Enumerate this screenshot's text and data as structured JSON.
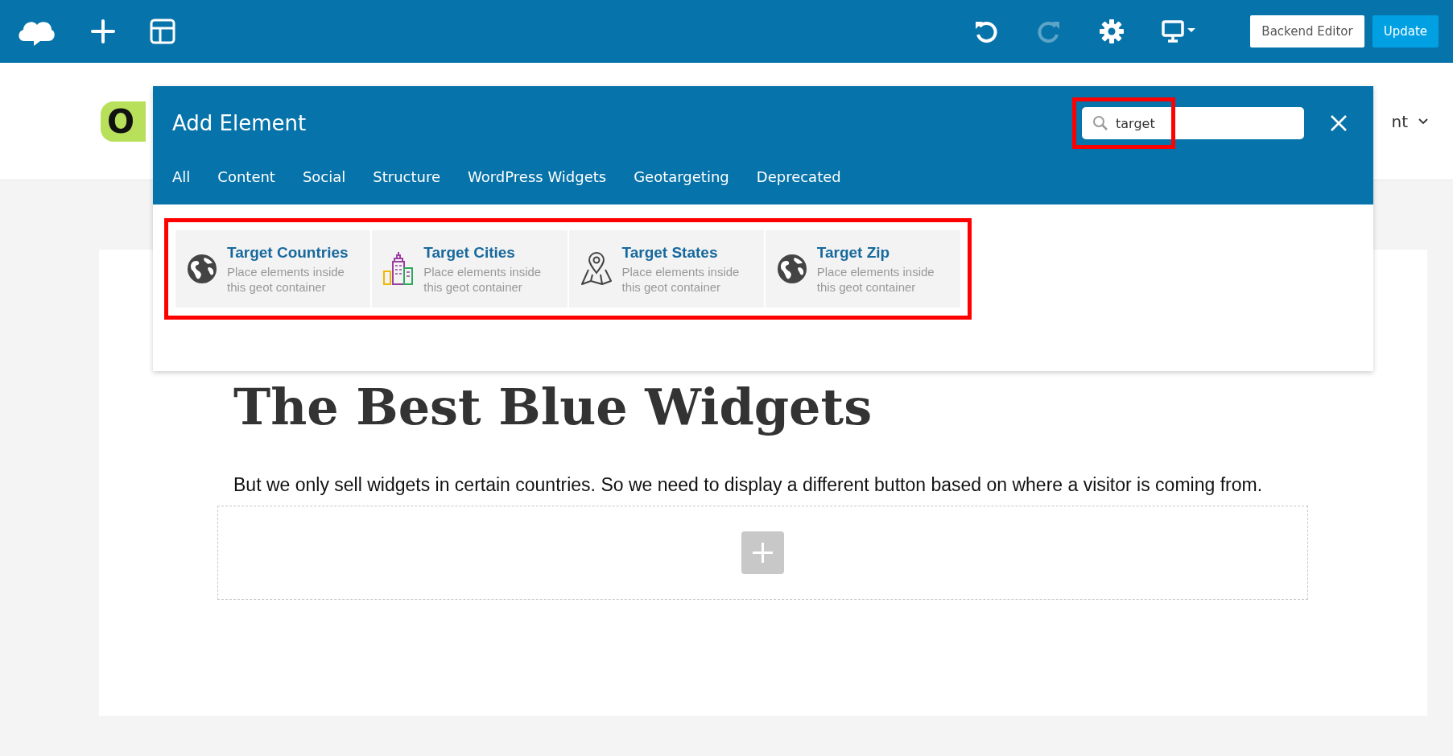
{
  "toolbar": {
    "left_icons": [
      {
        "kind": "logo",
        "disabled": false
      },
      {
        "kind": "add",
        "disabled": false
      },
      {
        "kind": "layout",
        "disabled": false
      }
    ],
    "right_icons": [
      {
        "kind": "undo",
        "disabled": false
      },
      {
        "kind": "redo",
        "disabled": true
      },
      {
        "kind": "settings",
        "disabled": false
      },
      {
        "kind": "device",
        "disabled": false
      }
    ],
    "buttons": [
      {
        "label": "Backend Editor",
        "kind": "secondary"
      },
      {
        "label": "Update",
        "kind": "primary"
      }
    ]
  },
  "site_header": {
    "logo_text": "O",
    "menu_item": "nt"
  },
  "modal": {
    "title": "Add Element",
    "search": {
      "value": "target",
      "highlighted": true
    },
    "tabs": [
      {
        "label": "All",
        "selected": false
      },
      {
        "label": "Content",
        "selected": false
      },
      {
        "label": "Social",
        "selected": false
      },
      {
        "label": "Structure",
        "selected": false
      },
      {
        "label": "WordPress Widgets",
        "selected": false
      },
      {
        "label": "Geotargeting",
        "selected": false
      },
      {
        "label": "Deprecated",
        "selected": false
      }
    ],
    "results_highlighted": true,
    "elements": [
      {
        "title": "Target Countries",
        "description": "Place elements inside this geot container",
        "kind": "globe"
      },
      {
        "title": "Target Cities",
        "description": "Place elements inside this geot container",
        "kind": "city"
      },
      {
        "title": "Target States",
        "description": "Place elements inside this geot container",
        "kind": "map"
      },
      {
        "title": "Target Zip",
        "description": "Place elements inside this geot container",
        "kind": "globe"
      }
    ]
  },
  "page": {
    "heading": "The Best Blue Widgets",
    "paragraph": "But we only sell widgets in certain countries. So we need to display a different button based on where a visitor is coming from."
  }
}
